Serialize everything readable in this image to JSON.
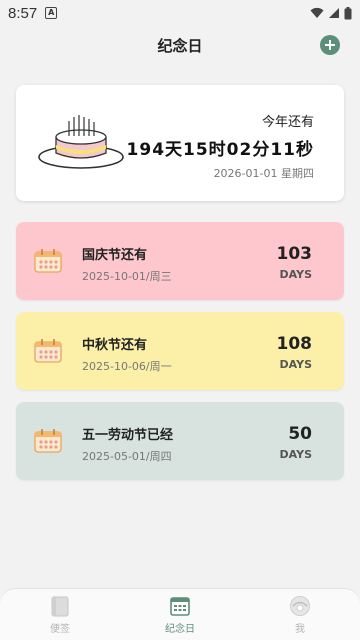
{
  "status": {
    "time": "8:57"
  },
  "header": {
    "title": "纪念日"
  },
  "hero": {
    "label": "今年还有",
    "countdown": "194天15时02分11秒",
    "date": "2026-01-01 星期四"
  },
  "events": [
    {
      "name": "国庆节还有",
      "date": "2025-10-01/周三",
      "days": "103",
      "unit": "DAYS",
      "color": "#fdc7cd"
    },
    {
      "name": "中秋节还有",
      "date": "2025-10-06/周一",
      "days": "108",
      "unit": "DAYS",
      "color": "#fcf0a8"
    },
    {
      "name": "五一劳动节已经",
      "date": "2025-05-01/周四",
      "days": "50",
      "unit": "DAYS",
      "color": "#d8e3df"
    }
  ],
  "tabs": [
    {
      "label": "便签",
      "icon": "notebook-icon",
      "active": false
    },
    {
      "label": "纪念日",
      "icon": "calendar-icon",
      "active": true
    },
    {
      "label": "我",
      "icon": "profile-icon",
      "active": false
    }
  ],
  "colors": {
    "accent": "#5b8f7a"
  }
}
